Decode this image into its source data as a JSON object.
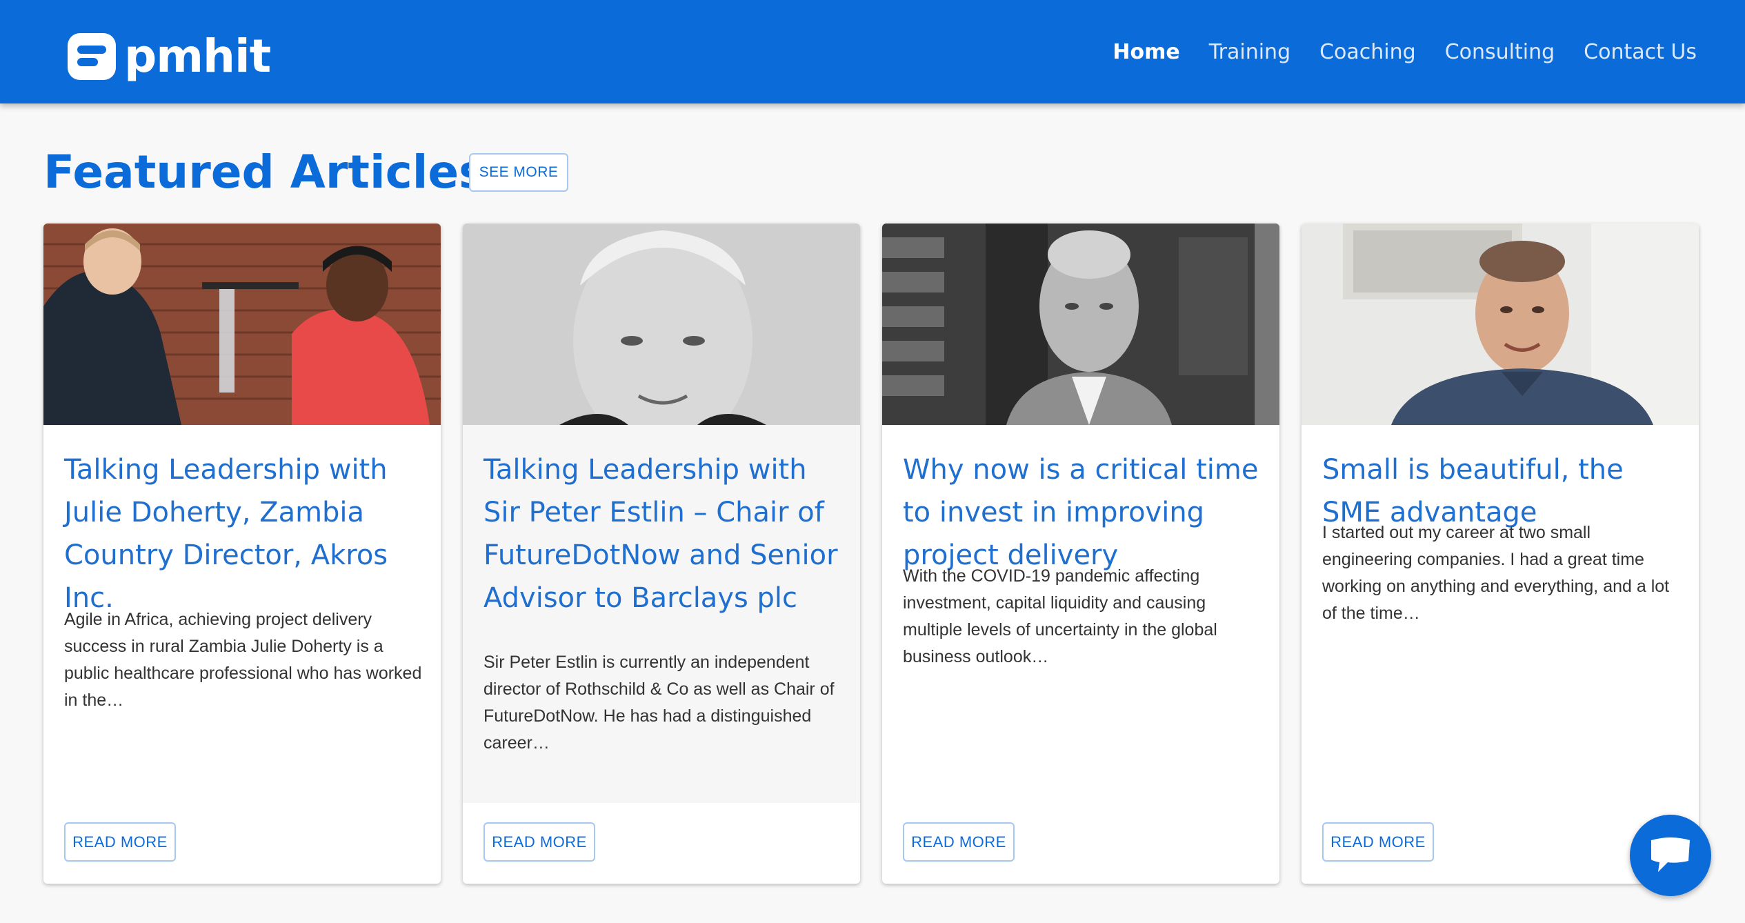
{
  "brand": {
    "name": "pmhit",
    "logo_icon": "pmhit-logo-icon",
    "primary_color": "#0b6bd8"
  },
  "nav": {
    "items": [
      {
        "label": "Home",
        "active": true
      },
      {
        "label": "Training",
        "active": false
      },
      {
        "label": "Coaching",
        "active": false
      },
      {
        "label": "Consulting",
        "active": false
      },
      {
        "label": "Contact Us",
        "active": false
      }
    ]
  },
  "featured": {
    "title": "Featured Articles",
    "see_more_label": "SEE MORE",
    "cards": [
      {
        "title": "Talking Leadership with Julie Doherty, Zambia Country Director, Akros Inc.",
        "excerpt": "Agile in Africa, achieving project delivery success in rural Zambia Julie Doherty is a public healthcare professional who has worked in the…",
        "read_more_label": "READ MORE",
        "image": "photo-two-women-with-water-filter"
      },
      {
        "title": "Talking Leadership with Sir Peter Estlin – Chair of FutureDotNow and Senior Advisor to Barclays plc",
        "excerpt": "Sir Peter Estlin is currently an independent director of Rothschild & Co as well as Chair of FutureDotNow. He has had a distinguished career…",
        "read_more_label": "READ MORE",
        "image": "portrait-older-man-black-and-white"
      },
      {
        "title": "Why now is a critical time to invest in improving project delivery",
        "excerpt": "With the COVID-19 pandemic affecting investment, capital liquidity and causing multiple levels of uncertainty in the global business outlook…",
        "read_more_label": "READ MORE",
        "image": "portrait-bald-man-in-office-black-and-white"
      },
      {
        "title": "Small is beautiful, the SME advantage",
        "excerpt": "I started out my career at two small engineering companies. I had a great time working on anything and everything, and a lot of the time…",
        "read_more_label": "READ MORE",
        "image": "portrait-smiling-man-in-blue-sweater"
      }
    ]
  },
  "chat": {
    "icon": "chat-bubble-icon"
  }
}
